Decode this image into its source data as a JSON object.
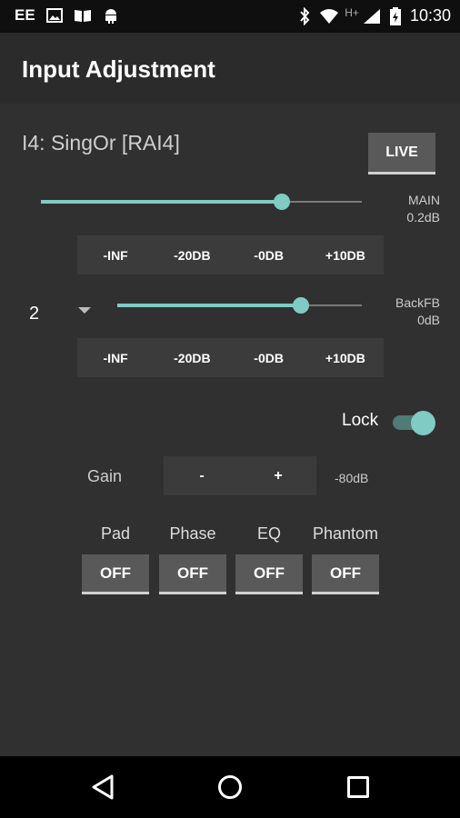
{
  "status_bar": {
    "carrier": "EE",
    "network": "H+",
    "time": "10:30"
  },
  "app_bar": {
    "title": "Input Adjustment"
  },
  "channel": {
    "name": "I4: SingOr  [RAI4]",
    "live_label": "LIVE"
  },
  "main_mix": {
    "name": "MAIN",
    "value": "0.2dB",
    "level": 0.75,
    "presets": [
      "-INF",
      "-20DB",
      "-0DB",
      "+10DB"
    ]
  },
  "aux_mix": {
    "selector_value": "2",
    "name": "BackFB",
    "value": "0dB",
    "level": 0.75,
    "presets": [
      "-INF",
      "-20DB",
      "-0DB",
      "+10DB"
    ]
  },
  "lock": {
    "label": "Lock",
    "on": true
  },
  "gain": {
    "label": "Gain",
    "minus": "-",
    "plus": "+",
    "value": "-80dB"
  },
  "toggles": [
    {
      "label": "Pad",
      "state": "OFF"
    },
    {
      "label": "Phase",
      "state": "OFF"
    },
    {
      "label": "EQ",
      "state": "OFF"
    },
    {
      "label": "Phantom",
      "state": "OFF"
    }
  ],
  "colors": {
    "accent": "#80cbc4",
    "background": "#303030",
    "button": "#595959"
  }
}
